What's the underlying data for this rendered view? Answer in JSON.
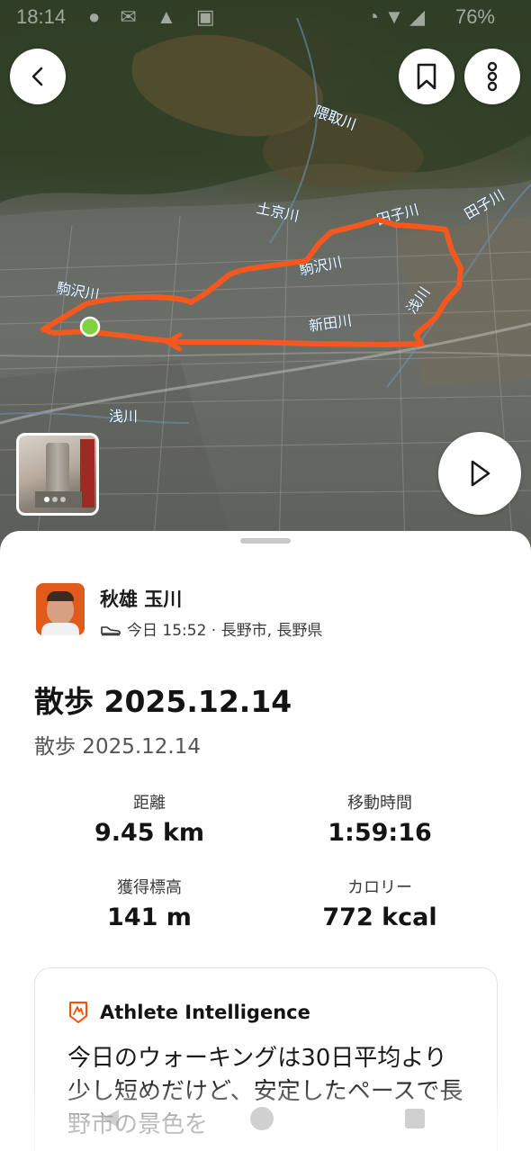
{
  "status_bar": {
    "time": "18:14",
    "battery": "76%"
  },
  "map": {
    "river_labels": [
      "隈取川",
      "土京川",
      "田子川",
      "駒沢川",
      "駒沢川",
      "浅川",
      "新田川",
      "浅川",
      "田子川"
    ],
    "route_color": "#f5581f",
    "start_marker_color": "#7fd33d"
  },
  "header_buttons": {
    "back_icon": "chevron-left-icon",
    "bookmark_icon": "bookmark-icon",
    "more_icon": "more-vertical-icon",
    "play_icon": "play-icon"
  },
  "activity": {
    "athlete_name": "秋雄 玉川",
    "meta": "今日 15:52 · 長野市, 長野県",
    "title": "散歩 2025.12.14",
    "subtitle": "散歩 2025.12.14",
    "stats": [
      {
        "label": "距離",
        "value": "9.45 km"
      },
      {
        "label": "移動時間",
        "value": "1:59:16"
      },
      {
        "label": "獲得標高",
        "value": "141 m"
      },
      {
        "label": "カロリー",
        "value": "772 kcal"
      }
    ]
  },
  "athlete_intelligence": {
    "title": "Athlete Intelligence",
    "body": "今日のウォーキングは30日平均より少し短めだけど、安定したペースで長野市の景色を"
  },
  "colors": {
    "accent": "#fc4c02",
    "sheet": "#ffffff"
  }
}
